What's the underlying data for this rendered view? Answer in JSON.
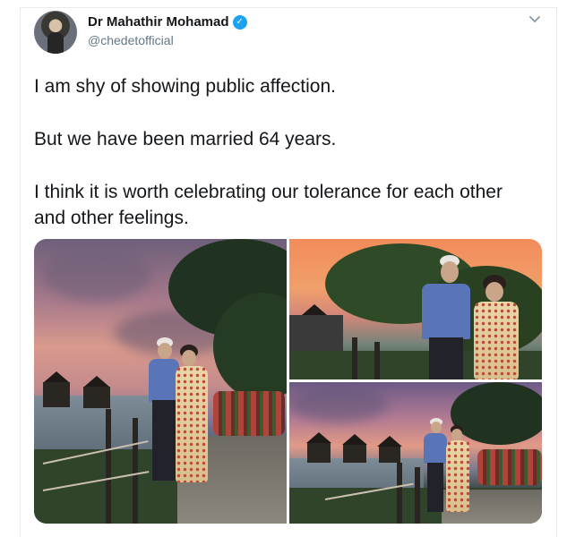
{
  "tweet": {
    "author_name": "Dr Mahathir Mohamad",
    "handle": "@chedetofficial",
    "paragraphs": [
      "I am shy of showing public affection.",
      "But we have been married 64 years.",
      "I think it is worth celebrating our tolerance for each other and other feelings."
    ]
  },
  "icons": {
    "avatar": "profile-photo",
    "verified": "verified-badge-icon",
    "menu": "chevron-down-icon"
  },
  "colors": {
    "verified_blue": "#1da1f2",
    "handle_gray": "#657786",
    "text": "#14171a",
    "border": "#e6ecf0"
  }
}
